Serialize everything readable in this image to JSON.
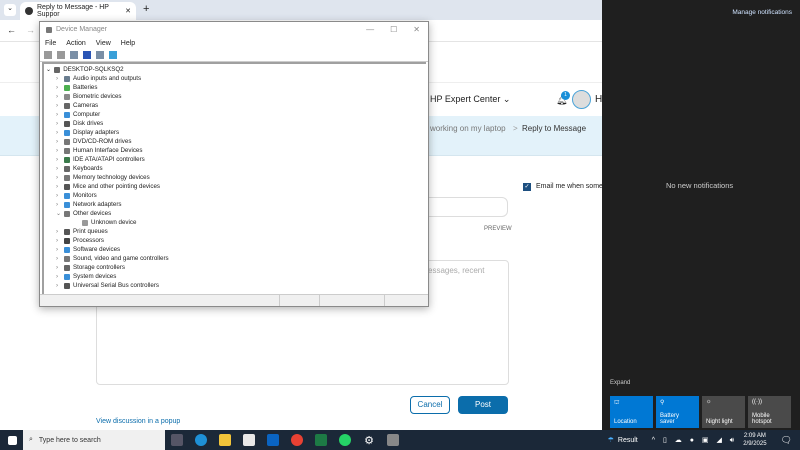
{
  "browser": {
    "tab_title": "Reply to Message - HP Suppor",
    "new_tab": "+",
    "close": "✕"
  },
  "page": {
    "header_link": "HP Expert Center",
    "notif_count": "1",
    "avatar_initial": "H",
    "breadcrumb_prev": "working on my laptop",
    "breadcrumb_sep": ">",
    "breadcrumb_current": "Reply to Message",
    "email_label": "Email me when someo",
    "preview": "PREVIEW",
    "textarea_hint": "essages, recent",
    "cancel": "Cancel",
    "post": "Post",
    "popup_link": "View discussion in a popup"
  },
  "device_manager": {
    "title": "Device Manager",
    "menu": [
      "File",
      "Action",
      "View",
      "Help"
    ],
    "root": "DESKTOP-SQLKSQ2",
    "items": [
      "Audio inputs and outputs",
      "Batteries",
      "Biometric devices",
      "Cameras",
      "Computer",
      "Disk drives",
      "Display adapters",
      "DVD/CD-ROM drives",
      "Human Interface Devices",
      "IDE ATA/ATAPI controllers",
      "Keyboards",
      "Memory technology devices",
      "Mice and other pointing devices",
      "Monitors",
      "Network adapters",
      "Other devices",
      "Unknown device",
      "Print queues",
      "Processors",
      "Software devices",
      "Sound, video and game controllers",
      "Storage controllers",
      "System devices",
      "Universal Serial Bus controllers"
    ]
  },
  "action_center": {
    "manage": "Manage notifications",
    "empty": "No new notifications",
    "expand": "Expand",
    "tiles": [
      {
        "label": "Location",
        "on": true
      },
      {
        "label": "Battery saver",
        "on": true
      },
      {
        "label": "Night light",
        "on": false
      },
      {
        "label": "Mobile hotspot",
        "on": false
      }
    ]
  },
  "taskbar": {
    "search_placeholder": "Type here to search",
    "weather": "Result",
    "time": "2:09 AM",
    "date": "2/9/2025"
  },
  "colors": {
    "accent": "#0078d4",
    "post": "#0b6dab"
  }
}
